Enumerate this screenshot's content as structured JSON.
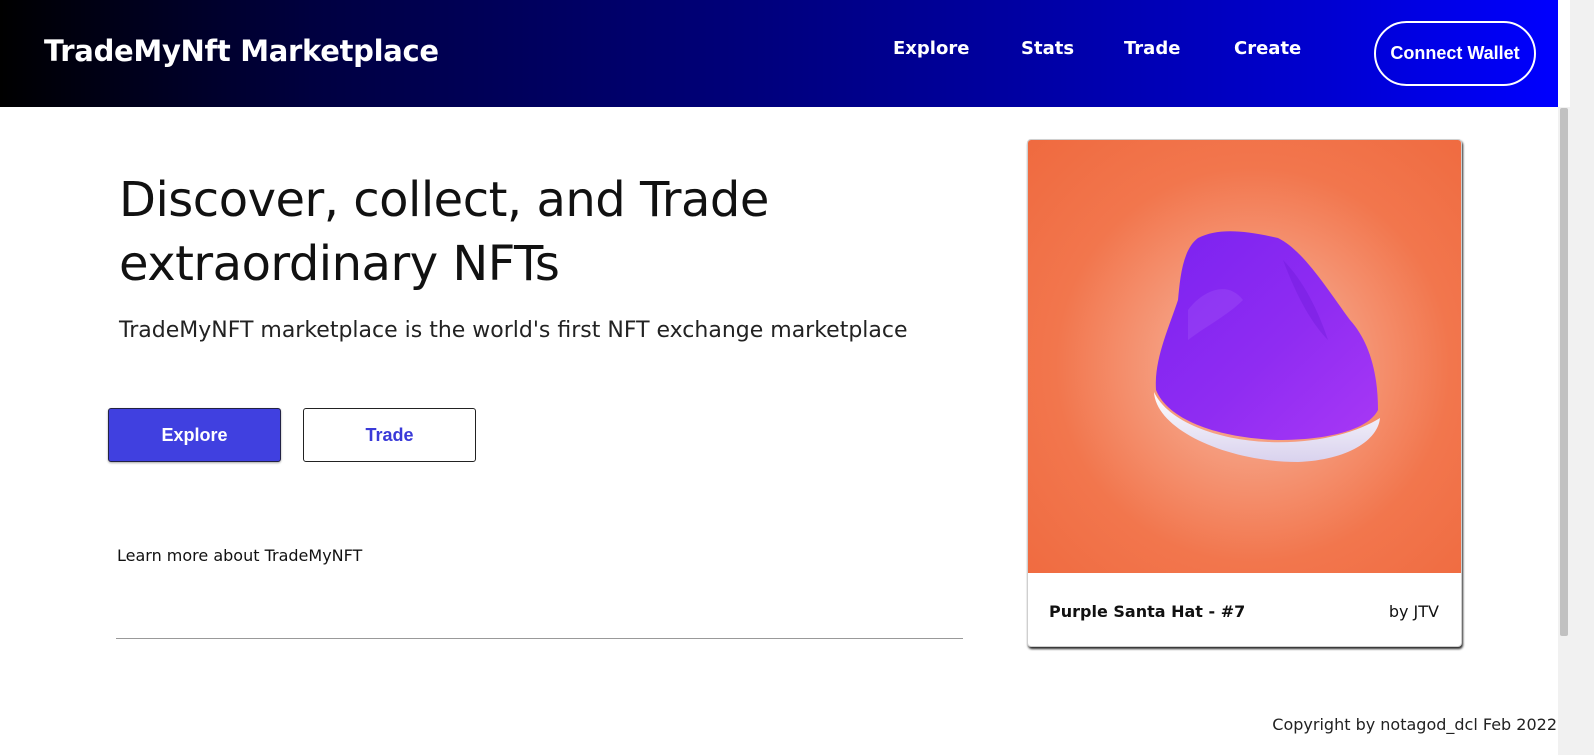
{
  "header": {
    "brand": "TradeMyNft Marketplace",
    "nav": {
      "explore": "Explore",
      "stats": "Stats",
      "trade": "Trade",
      "create": "Create"
    },
    "connect_wallet_label": "Connect Wallet"
  },
  "hero": {
    "title": "Discover, collect, and Trade extraordinary NFTs",
    "subtitle": "TradeMyNFT marketplace is the world's first NFT exchange marketplace",
    "explore_button": "Explore",
    "trade_button": "Trade",
    "learn_more": "Learn more about TradeMyNFT"
  },
  "featured_nft": {
    "name": "Purple Santa Hat - #7",
    "creator": "by JTV",
    "image_icon": "purple-santa-hat"
  },
  "footer": {
    "copyright": "Copyright by notagod_dcl Feb 2022"
  },
  "colors": {
    "header_gradient_start": "#000000",
    "header_gradient_end": "#0000ff",
    "primary_button": "#4040e0",
    "nft_background": "#f2764d",
    "hat_color": "#8a2be2"
  }
}
